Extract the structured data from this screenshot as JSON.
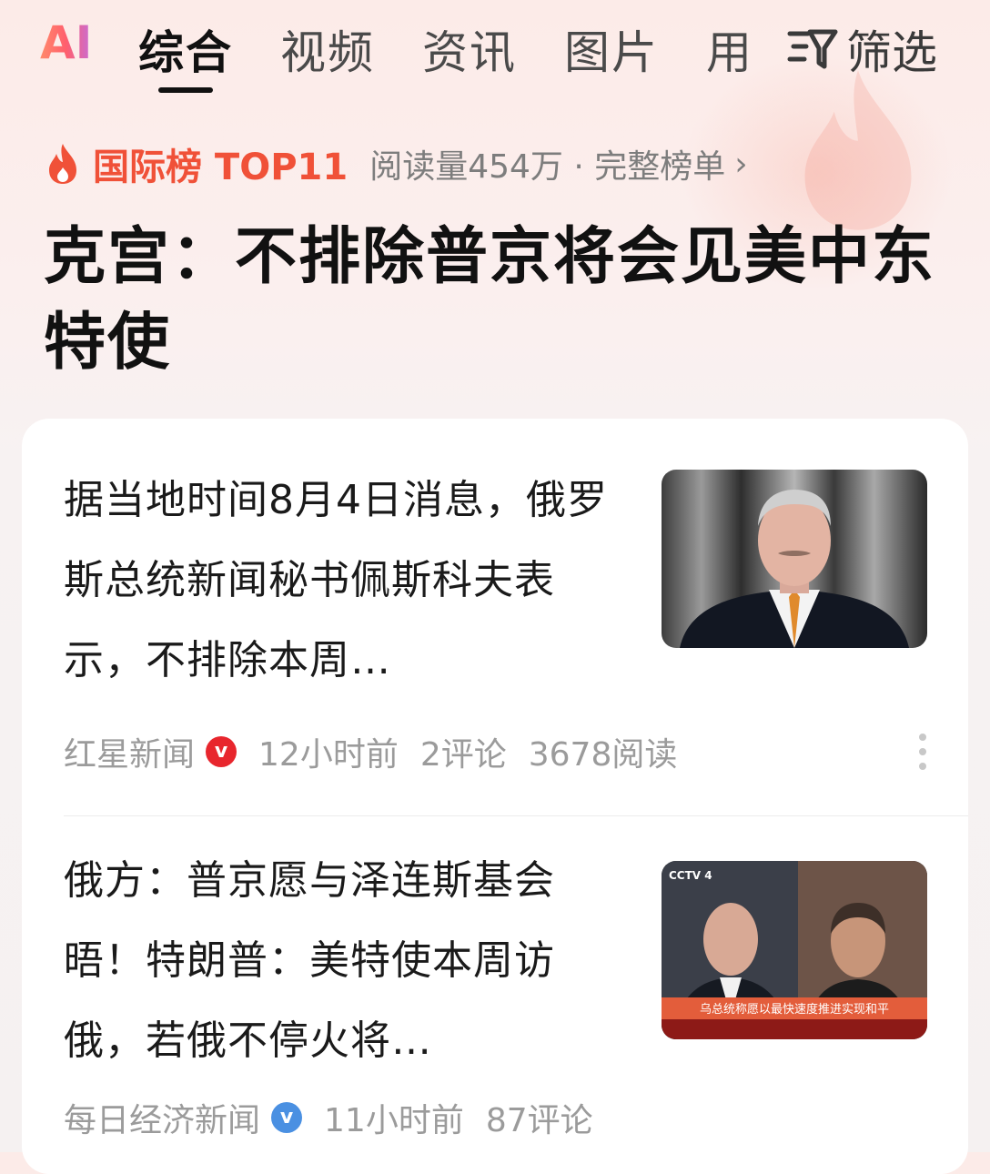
{
  "tabs": {
    "ai": "AI",
    "items": [
      "综合",
      "视频",
      "资讯",
      "图片",
      "用"
    ],
    "active_index": 0,
    "filter_label": "筛选"
  },
  "hot_list": {
    "title": "国际榜 TOP11",
    "meta": "阅读量454万 · 完整榜单",
    "chevron": "›"
  },
  "headline": "克宫：不排除普京将会见美中东特使",
  "articles": [
    {
      "text": "据当地时间8月4日消息，俄罗斯总统新闻秘书佩斯科夫表示，不排除本周…",
      "source": "红星新闻",
      "badge": "v",
      "badge_color": "#e8262d",
      "time": "12小时前",
      "comments": "2评论",
      "reads": "3678阅读"
    },
    {
      "text": "俄方：普京愿与泽连斯基会晤！特朗普：美特使本周访俄，若俄不停火将…",
      "source": "每日经济新闻",
      "badge": "v",
      "badge_color": "#4a90e2",
      "time": "11小时前",
      "comments": "87评论",
      "thumb_channel": "CCTV 4",
      "thumb_caption": "乌总统称愿以最快速度推进实现和平"
    }
  ],
  "colors": {
    "accent": "#f05138",
    "meta_gray": "#9b9b9b"
  }
}
